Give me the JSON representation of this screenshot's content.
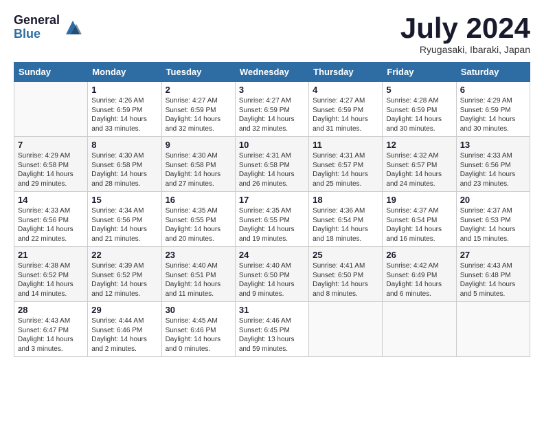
{
  "header": {
    "logo_general": "General",
    "logo_blue": "Blue",
    "month_title": "July 2024",
    "location": "Ryugasaki, Ibaraki, Japan"
  },
  "weekdays": [
    "Sunday",
    "Monday",
    "Tuesday",
    "Wednesday",
    "Thursday",
    "Friday",
    "Saturday"
  ],
  "weeks": [
    [
      {
        "day": "",
        "info": ""
      },
      {
        "day": "1",
        "info": "Sunrise: 4:26 AM\nSunset: 6:59 PM\nDaylight: 14 hours\nand 33 minutes."
      },
      {
        "day": "2",
        "info": "Sunrise: 4:27 AM\nSunset: 6:59 PM\nDaylight: 14 hours\nand 32 minutes."
      },
      {
        "day": "3",
        "info": "Sunrise: 4:27 AM\nSunset: 6:59 PM\nDaylight: 14 hours\nand 32 minutes."
      },
      {
        "day": "4",
        "info": "Sunrise: 4:27 AM\nSunset: 6:59 PM\nDaylight: 14 hours\nand 31 minutes."
      },
      {
        "day": "5",
        "info": "Sunrise: 4:28 AM\nSunset: 6:59 PM\nDaylight: 14 hours\nand 30 minutes."
      },
      {
        "day": "6",
        "info": "Sunrise: 4:29 AM\nSunset: 6:59 PM\nDaylight: 14 hours\nand 30 minutes."
      }
    ],
    [
      {
        "day": "7",
        "info": "Sunrise: 4:29 AM\nSunset: 6:58 PM\nDaylight: 14 hours\nand 29 minutes."
      },
      {
        "day": "8",
        "info": "Sunrise: 4:30 AM\nSunset: 6:58 PM\nDaylight: 14 hours\nand 28 minutes."
      },
      {
        "day": "9",
        "info": "Sunrise: 4:30 AM\nSunset: 6:58 PM\nDaylight: 14 hours\nand 27 minutes."
      },
      {
        "day": "10",
        "info": "Sunrise: 4:31 AM\nSunset: 6:58 PM\nDaylight: 14 hours\nand 26 minutes."
      },
      {
        "day": "11",
        "info": "Sunrise: 4:31 AM\nSunset: 6:57 PM\nDaylight: 14 hours\nand 25 minutes."
      },
      {
        "day": "12",
        "info": "Sunrise: 4:32 AM\nSunset: 6:57 PM\nDaylight: 14 hours\nand 24 minutes."
      },
      {
        "day": "13",
        "info": "Sunrise: 4:33 AM\nSunset: 6:56 PM\nDaylight: 14 hours\nand 23 minutes."
      }
    ],
    [
      {
        "day": "14",
        "info": "Sunrise: 4:33 AM\nSunset: 6:56 PM\nDaylight: 14 hours\nand 22 minutes."
      },
      {
        "day": "15",
        "info": "Sunrise: 4:34 AM\nSunset: 6:56 PM\nDaylight: 14 hours\nand 21 minutes."
      },
      {
        "day": "16",
        "info": "Sunrise: 4:35 AM\nSunset: 6:55 PM\nDaylight: 14 hours\nand 20 minutes."
      },
      {
        "day": "17",
        "info": "Sunrise: 4:35 AM\nSunset: 6:55 PM\nDaylight: 14 hours\nand 19 minutes."
      },
      {
        "day": "18",
        "info": "Sunrise: 4:36 AM\nSunset: 6:54 PM\nDaylight: 14 hours\nand 18 minutes."
      },
      {
        "day": "19",
        "info": "Sunrise: 4:37 AM\nSunset: 6:54 PM\nDaylight: 14 hours\nand 16 minutes."
      },
      {
        "day": "20",
        "info": "Sunrise: 4:37 AM\nSunset: 6:53 PM\nDaylight: 14 hours\nand 15 minutes."
      }
    ],
    [
      {
        "day": "21",
        "info": "Sunrise: 4:38 AM\nSunset: 6:52 PM\nDaylight: 14 hours\nand 14 minutes."
      },
      {
        "day": "22",
        "info": "Sunrise: 4:39 AM\nSunset: 6:52 PM\nDaylight: 14 hours\nand 12 minutes."
      },
      {
        "day": "23",
        "info": "Sunrise: 4:40 AM\nSunset: 6:51 PM\nDaylight: 14 hours\nand 11 minutes."
      },
      {
        "day": "24",
        "info": "Sunrise: 4:40 AM\nSunset: 6:50 PM\nDaylight: 14 hours\nand 9 minutes."
      },
      {
        "day": "25",
        "info": "Sunrise: 4:41 AM\nSunset: 6:50 PM\nDaylight: 14 hours\nand 8 minutes."
      },
      {
        "day": "26",
        "info": "Sunrise: 4:42 AM\nSunset: 6:49 PM\nDaylight: 14 hours\nand 6 minutes."
      },
      {
        "day": "27",
        "info": "Sunrise: 4:43 AM\nSunset: 6:48 PM\nDaylight: 14 hours\nand 5 minutes."
      }
    ],
    [
      {
        "day": "28",
        "info": "Sunrise: 4:43 AM\nSunset: 6:47 PM\nDaylight: 14 hours\nand 3 minutes."
      },
      {
        "day": "29",
        "info": "Sunrise: 4:44 AM\nSunset: 6:46 PM\nDaylight: 14 hours\nand 2 minutes."
      },
      {
        "day": "30",
        "info": "Sunrise: 4:45 AM\nSunset: 6:46 PM\nDaylight: 14 hours\nand 0 minutes."
      },
      {
        "day": "31",
        "info": "Sunrise: 4:46 AM\nSunset: 6:45 PM\nDaylight: 13 hours\nand 59 minutes."
      },
      {
        "day": "",
        "info": ""
      },
      {
        "day": "",
        "info": ""
      },
      {
        "day": "",
        "info": ""
      }
    ]
  ]
}
